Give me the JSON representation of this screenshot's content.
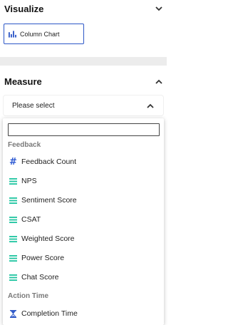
{
  "visualize": {
    "title": "Visualize",
    "chart_chip": {
      "label": "Column Chart",
      "icon": "column-chart-icon"
    }
  },
  "measure": {
    "title": "Measure",
    "select": {
      "value": "Please select"
    },
    "search": {
      "value": ""
    },
    "groups": [
      {
        "label": "Feedback",
        "items": [
          {
            "label": "Feedback Count",
            "icon": "hash-icon"
          },
          {
            "label": "NPS",
            "icon": "score-icon"
          },
          {
            "label": "Sentiment Score",
            "icon": "score-icon"
          },
          {
            "label": "CSAT",
            "icon": "score-icon"
          },
          {
            "label": "Weighted Score",
            "icon": "score-icon"
          },
          {
            "label": "Power Score",
            "icon": "score-icon"
          },
          {
            "label": "Chat Score",
            "icon": "score-icon"
          }
        ]
      },
      {
        "label": "Action Time",
        "items": [
          {
            "label": "Completion Time",
            "icon": "hourglass-icon"
          }
        ]
      }
    ]
  },
  "colors": {
    "accent": "#2d57c7",
    "score_icon": "#1ec4a0",
    "group_label": "#7a7a7a"
  }
}
